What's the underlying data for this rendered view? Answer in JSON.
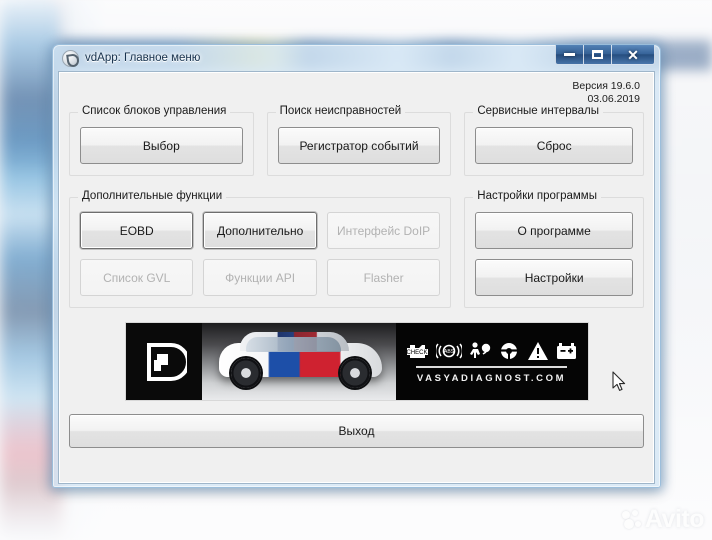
{
  "window": {
    "title": "vdApp:  Главное меню",
    "icon": "app-logo-icon",
    "controls": {
      "minimize": "—",
      "maximize": "◻",
      "close": "✕"
    }
  },
  "info": {
    "version": "Версия 19.6.0",
    "date": "03.06.2019"
  },
  "groups": {
    "control_blocks": {
      "title": "Список блоков управления",
      "buttons": [
        {
          "label": "Выбор",
          "state": "enabled"
        }
      ]
    },
    "fault_search": {
      "title": "Поиск неисправностей",
      "buttons": [
        {
          "label": "Регистратор событий",
          "state": "enabled"
        }
      ]
    },
    "service_intervals": {
      "title": "Сервисные интервалы",
      "buttons": [
        {
          "label": "Сброс",
          "state": "enabled"
        }
      ]
    },
    "extra_functions": {
      "title": "Дополнительные функции",
      "buttons": [
        {
          "label": "EOBD",
          "state": "enabled"
        },
        {
          "label": "Дополнительно",
          "state": "enabled"
        },
        {
          "label": "Интерфейс DoIP",
          "state": "disabled"
        },
        {
          "label": "Список GVL",
          "state": "disabled"
        },
        {
          "label": "Функции API",
          "state": "disabled"
        },
        {
          "label": "Flasher",
          "state": "disabled"
        }
      ]
    },
    "program_settings": {
      "title": "Настройки программы",
      "buttons": [
        {
          "label": "О программе",
          "state": "enabled"
        },
        {
          "label": "Настройки",
          "state": "enabled"
        }
      ]
    }
  },
  "banner": {
    "logo": "vasyadiagnost-logo-icon",
    "car_image": "car-photo",
    "icons": [
      "check-engine-icon",
      "abs-icon",
      "airbag-icon",
      "steering-wheel-icon",
      "warning-triangle-icon",
      "battery-icon"
    ],
    "url": "VASYADIAGNOST.COM"
  },
  "footer": {
    "exit_label": "Выход"
  },
  "watermark": {
    "label": "Avito"
  },
  "colors": {
    "client_bg": "#f0f0f0",
    "titlebar": "#2e5c94",
    "car_blue": "#1d4fa8",
    "car_red": "#cf2230",
    "disabled_text": "#b2b2b2"
  }
}
